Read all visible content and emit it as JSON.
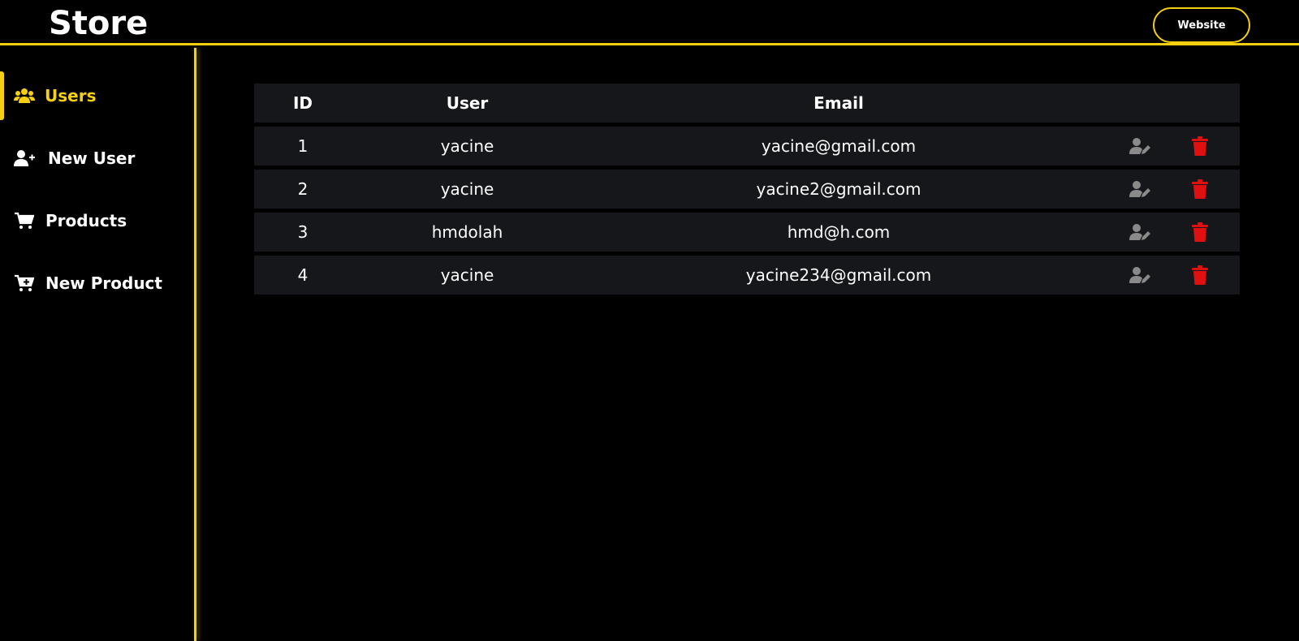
{
  "header": {
    "brand": "Store",
    "website_button": "Website"
  },
  "sidebar": {
    "items": [
      {
        "label": "Users",
        "icon": "users-icon",
        "active": true
      },
      {
        "label": "New User",
        "icon": "user-plus-icon",
        "active": false
      },
      {
        "label": "Products",
        "icon": "cart-icon",
        "active": false
      },
      {
        "label": "New Product",
        "icon": "cart-plus-icon",
        "active": false
      }
    ]
  },
  "table": {
    "columns": [
      "ID",
      "User",
      "Email"
    ],
    "rows": [
      {
        "id": "1",
        "user": "yacine",
        "email": "yacine@gmail.com"
      },
      {
        "id": "2",
        "user": "yacine",
        "email": "yacine2@gmail.com"
      },
      {
        "id": "3",
        "user": "hmdolah",
        "email": "hmd@h.com"
      },
      {
        "id": "4",
        "user": "yacine",
        "email": "yacine234@gmail.com"
      }
    ],
    "actions": {
      "edit_icon": "user-edit-icon",
      "delete_icon": "trash-icon"
    }
  },
  "colors": {
    "accent": "#f5d010",
    "background": "#000000",
    "row_background": "#16171b",
    "edit_icon": "#8a8a8a",
    "delete_icon": "#e01010"
  }
}
